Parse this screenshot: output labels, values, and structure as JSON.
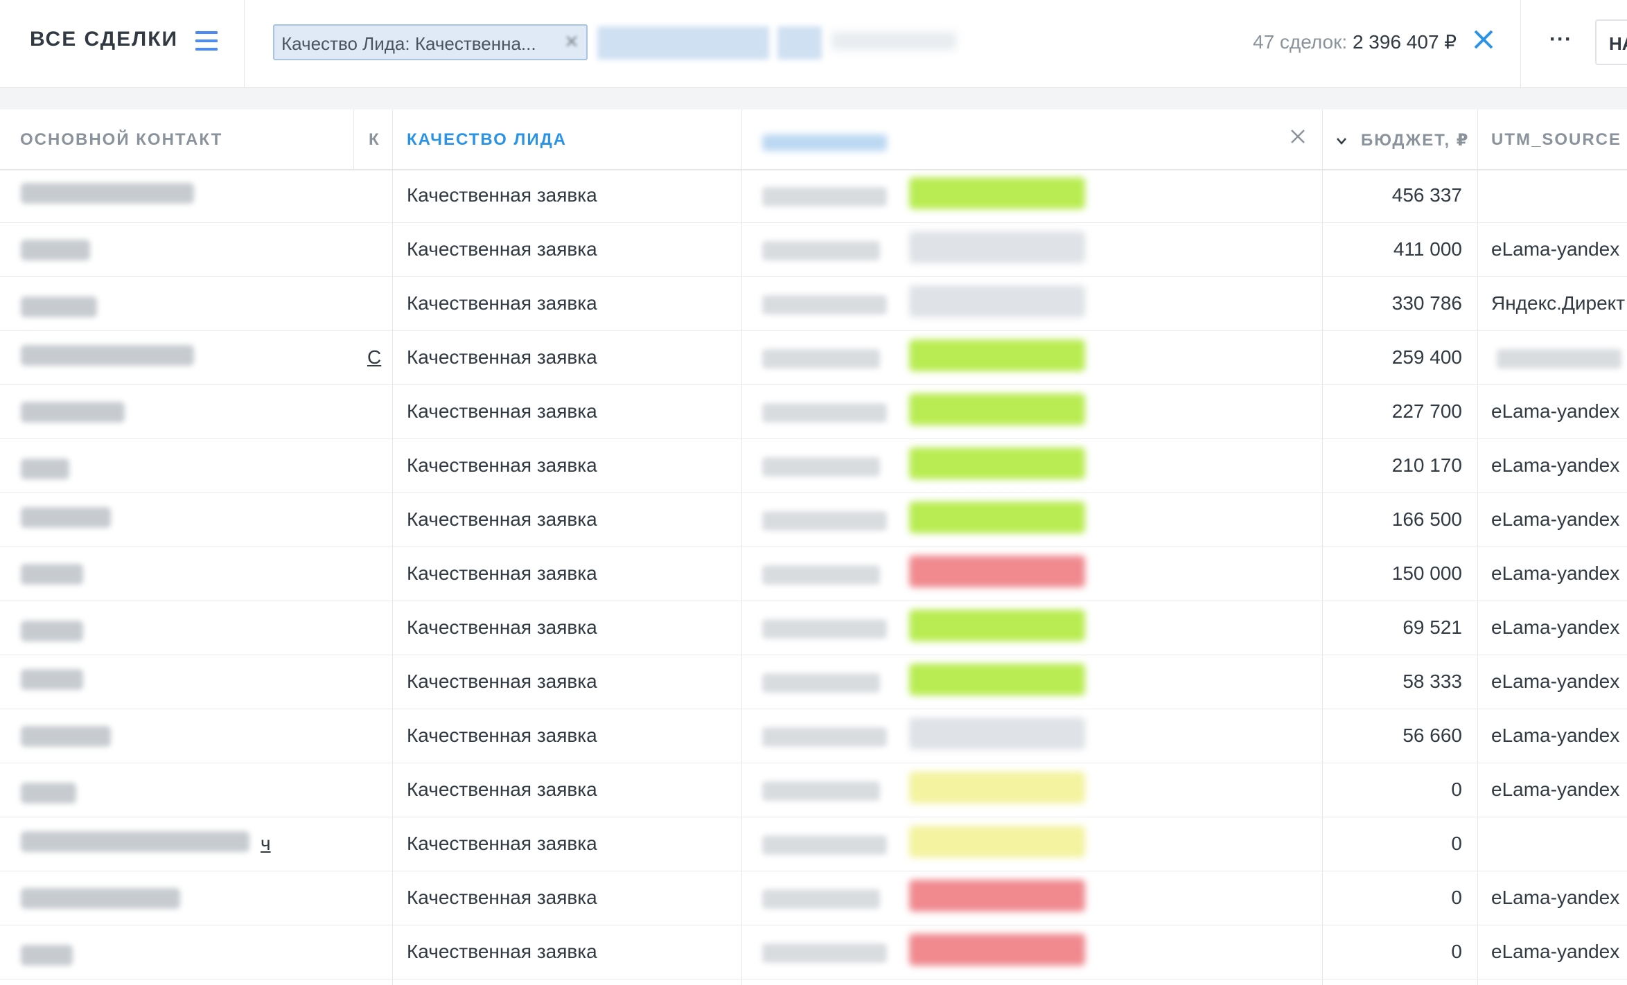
{
  "header": {
    "title": "ВСЕ СДЕЛКИ",
    "filter_chip": "Качество Лида: Качественна...",
    "summary_count": "47 сделок:",
    "summary_total": "2 396 407 ₽",
    "more_label": "···",
    "new_button": "НА"
  },
  "columns": {
    "contact": "ОСНОВНОЙ КОНТАКТ",
    "k": "К",
    "quality": "КАЧЕСТВО ЛИДА",
    "budget": "БЮДЖЕТ, ₽",
    "utm": "UTM_SOURCE"
  },
  "rows": [
    {
      "quality": "Качественная заявка",
      "budget": "456 337",
      "utm": "",
      "k": "",
      "tag": "#b9ec52"
    },
    {
      "quality": "Качественная заявка",
      "budget": "411 000",
      "utm": "eLama-yandex",
      "k": "",
      "tag": "#dfe2e6"
    },
    {
      "quality": "Качественная заявка",
      "budget": "330 786",
      "utm": "Яндекс.Директ",
      "k": "",
      "tag": "#dfe2e6"
    },
    {
      "quality": "Качественная заявка",
      "budget": "259 400",
      "utm": "",
      "k": "С",
      "tag": "#b9ec52"
    },
    {
      "quality": "Качественная заявка",
      "budget": "227 700",
      "utm": "eLama-yandex",
      "k": "",
      "tag": "#b9ec52"
    },
    {
      "quality": "Качественная заявка",
      "budget": "210 170",
      "utm": "eLama-yandex",
      "k": "",
      "tag": "#b9ec52"
    },
    {
      "quality": "Качественная заявка",
      "budget": "166 500",
      "utm": "eLama-yandex",
      "k": "",
      "tag": "#b9ec52"
    },
    {
      "quality": "Качественная заявка",
      "budget": "150 000",
      "utm": "eLama-yandex",
      "k": "",
      "tag": "#f08a8f"
    },
    {
      "quality": "Качественная заявка",
      "budget": "69 521",
      "utm": "eLama-yandex",
      "k": "",
      "tag": "#b9ec52"
    },
    {
      "quality": "Качественная заявка",
      "budget": "58 333",
      "utm": "eLama-yandex",
      "k": "",
      "tag": "#b9ec52"
    },
    {
      "quality": "Качественная заявка",
      "budget": "56 660",
      "utm": "eLama-yandex",
      "k": "",
      "tag": "#dfe2e6"
    },
    {
      "quality": "Качественная заявка",
      "budget": "0",
      "utm": "eLama-yandex",
      "k": "",
      "tag": "#f4f3a0"
    },
    {
      "quality": "Качественная заявка",
      "budget": "0",
      "utm": "",
      "k": "ч",
      "tag": "#f4f3a0"
    },
    {
      "quality": "Качественная заявка",
      "budget": "0",
      "utm": "eLama-yandex",
      "k": "",
      "tag": "#f08a8f"
    },
    {
      "quality": "Качественная заявка",
      "budget": "0",
      "utm": "eLama-yandex",
      "k": "",
      "tag": "#f08a8f"
    }
  ],
  "colors": {
    "accent": "#2a93e6",
    "menu_icon": "#4c8bf7"
  },
  "icons": {
    "menu": "hamburger-icon",
    "close": "close-icon",
    "sort": "chevron-down-icon"
  }
}
